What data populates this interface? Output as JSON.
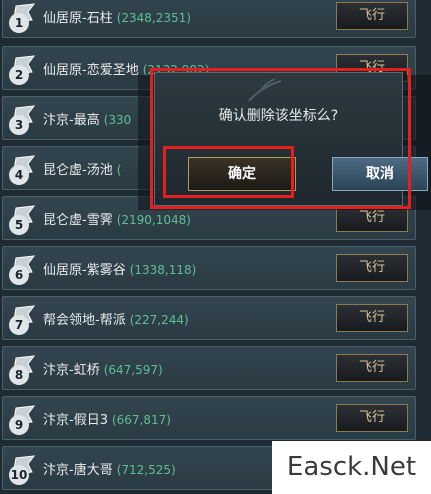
{
  "rows": [
    {
      "num": "1",
      "name": "仙居原-石柱",
      "coord": "(2348,2351)",
      "fly": "飞行"
    },
    {
      "num": "2",
      "name": "仙居原-恋爱圣地",
      "coord": "(2132,982)",
      "fly": "飞行"
    },
    {
      "num": "3",
      "name": "汴京-最高",
      "coord": "(330",
      "fly": ""
    },
    {
      "num": "4",
      "name": "昆仑虚-汤池",
      "coord": "(",
      "fly": ""
    },
    {
      "num": "5",
      "name": "昆仑虚-雪霁",
      "coord": "(2190,1048)",
      "fly": "飞行"
    },
    {
      "num": "6",
      "name": "仙居原-紫雾谷",
      "coord": "(1338,118)",
      "fly": "飞行"
    },
    {
      "num": "7",
      "name": "帮会领地-帮派",
      "coord": "(227,244)",
      "fly": "飞行"
    },
    {
      "num": "8",
      "name": "汴京-虹桥",
      "coord": "(647,597)",
      "fly": "飞行"
    },
    {
      "num": "9",
      "name": "汴京-假日3",
      "coord": "(667,817)",
      "fly": "飞行"
    },
    {
      "num": "10",
      "name": "汴京-唐大哥",
      "coord": "(712,525)",
      "fly": ""
    }
  ],
  "dialog": {
    "message": "确认删除该坐标么?",
    "confirm": "确定",
    "cancel": "取消"
  },
  "watermark": "Easck.Net"
}
